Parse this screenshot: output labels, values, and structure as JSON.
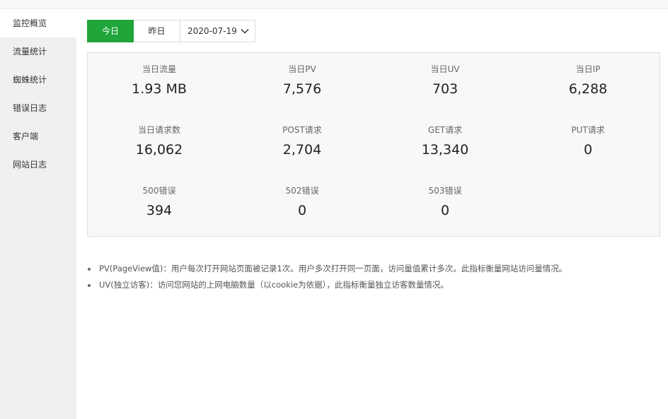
{
  "sidebar": {
    "items": [
      {
        "label": "监控概览",
        "active": true
      },
      {
        "label": "流量统计",
        "active": false
      },
      {
        "label": "蜘蛛统计",
        "active": false
      },
      {
        "label": "错误日志",
        "active": false
      },
      {
        "label": "客户端",
        "active": false
      },
      {
        "label": "网站日志",
        "active": false
      }
    ]
  },
  "datebar": {
    "today_label": "今日",
    "yesterday_label": "昨日",
    "selected_date": "2020-07-19",
    "dropdown_icon": "chevron-down-icon"
  },
  "stats": {
    "day_traffic": {
      "label": "当日流量",
      "value": "1.93 MB"
    },
    "day_pv": {
      "label": "当日PV",
      "value": "7,576"
    },
    "day_uv": {
      "label": "当日UV",
      "value": "703"
    },
    "day_ip": {
      "label": "当日IP",
      "value": "6,288"
    },
    "day_requests": {
      "label": "当日请求数",
      "value": "16,062"
    },
    "post_requests": {
      "label": "POST请求",
      "value": "2,704"
    },
    "get_requests": {
      "label": "GET请求",
      "value": "13,340"
    },
    "put_requests": {
      "label": "PUT请求",
      "value": "0"
    },
    "error_500": {
      "label": "500错误",
      "value": "394"
    },
    "error_502": {
      "label": "502错误",
      "value": "0"
    },
    "error_503": {
      "label": "503错误",
      "value": "0"
    }
  },
  "notes": [
    "PV(PageView值)：用户每次打开网站页面被记录1次。用户多次打开同一页面，访问量值累计多次。此指标衡量网站访问量情况。",
    "UV(独立访客)：访问您网站的上网电脑数量（以cookie为依据），此指标衡量独立访客数量情况。"
  ],
  "colors": {
    "accent": "#20a53a",
    "sidebar_bg": "#f0f0f0",
    "panel_bg": "#f8f8f8"
  }
}
